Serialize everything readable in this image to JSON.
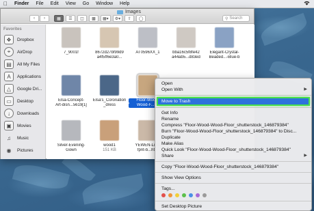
{
  "menubar": {
    "apple": "",
    "items": [
      "Finder",
      "File",
      "Edit",
      "View",
      "Go",
      "Window",
      "Help"
    ],
    "right_icons": [
      "wifi-icon"
    ]
  },
  "window": {
    "title": "Images",
    "search_placeholder": "Search"
  },
  "sidebar": {
    "section": "Favorites",
    "items": [
      {
        "label": "Dropbox",
        "icon": "dropbox-icon"
      },
      {
        "label": "AirDrop",
        "icon": "airdrop-icon"
      },
      {
        "label": "All My Files",
        "icon": "all-files-icon"
      },
      {
        "label": "Applications",
        "icon": "applications-icon"
      },
      {
        "label": "Google Dri...",
        "icon": "google-drive-icon"
      },
      {
        "label": "Desktop",
        "icon": "desktop-icon"
      },
      {
        "label": "Downloads",
        "icon": "downloads-icon"
      },
      {
        "label": "Movies",
        "icon": "movies-icon"
      },
      {
        "label": "Music",
        "icon": "music-icon"
      },
      {
        "label": "Pictures",
        "icon": "pictures-icon"
      }
    ]
  },
  "files": [
    {
      "name": "7_9001f",
      "name2": "",
      "size": "",
      "color": "#c9c3bd"
    },
    {
      "name": "8672d27bf99d9",
      "name2": "a4f5ff6e3a0...",
      "size": "",
      "color": "#d6c6b2"
    },
    {
      "name": "AT0596XX_1",
      "name2": "",
      "size": "",
      "color": "#bdbfc6"
    },
    {
      "name": "bba16c5f8fe42",
      "name2": "a44ab5...d83ed",
      "size": "",
      "color": "#cfc9c3"
    },
    {
      "name": "Elegant-Crystal-",
      "name2": "Beaded...-Blue-b",
      "size": "",
      "color": "#8aa2c4"
    },
    {
      "name": "Elsa-Concept-",
      "name2": "Art-disn...5619[1]",
      "size": "",
      "color": "#6f86a8"
    },
    {
      "name": "Elsa's_Coronation",
      "name2": "_dress",
      "size": "",
      "color": "#4b6788"
    },
    {
      "name": "Floor-Wood-",
      "name2": "Wood-F...87",
      "size": "",
      "color": "#c7a67f",
      "selected": true
    },
    {
      "name": "Silver-Evening-",
      "name2": "Gown",
      "size": "",
      "color": "#b6b8bd"
    },
    {
      "name": "wood1",
      "name2": "",
      "size": "151 KB",
      "color": "#c9a07a"
    },
    {
      "name": "YEWEN-Luxu",
      "name2": "fpnt-b...ht...",
      "size": "",
      "color": "#cbb9a8"
    }
  ],
  "context_menu": {
    "group1": [
      {
        "label": "Open",
        "submenu": false
      },
      {
        "label": "Open With",
        "submenu": true
      }
    ],
    "highlighted": "Move to Trash",
    "group2": [
      {
        "label": "Get Info",
        "submenu": false
      },
      {
        "label": "Rename",
        "submenu": false
      },
      {
        "label": "Compress \"Floor-Wood-Wood-Floor_shutterstock_146879384\"",
        "submenu": false
      },
      {
        "label": "Burn \"Floor-Wood-Wood-Floor_shutterstock_146879384\" to Disc...",
        "submenu": false
      },
      {
        "label": "Duplicate",
        "submenu": false
      },
      {
        "label": "Make Alias",
        "submenu": false
      },
      {
        "label": "Quick Look \"Floor-Wood-Wood-Floor_shutterstock_146879384\"",
        "submenu": false
      },
      {
        "label": "Share",
        "submenu": true
      }
    ],
    "group3": [
      {
        "label": "Copy \"Floor-Wood-Wood-Floor_shutterstock_146879384\"",
        "submenu": false
      }
    ],
    "group4": [
      {
        "label": "Show View Options",
        "submenu": false
      }
    ],
    "tags_label": "Tags...",
    "tag_colors": [
      "#e2504c",
      "#f0963a",
      "#f2cf3a",
      "#5cc04a",
      "#4a8fe6",
      "#a86ad8",
      "#9a9a9a"
    ],
    "last": "Set Desktop Picture"
  }
}
